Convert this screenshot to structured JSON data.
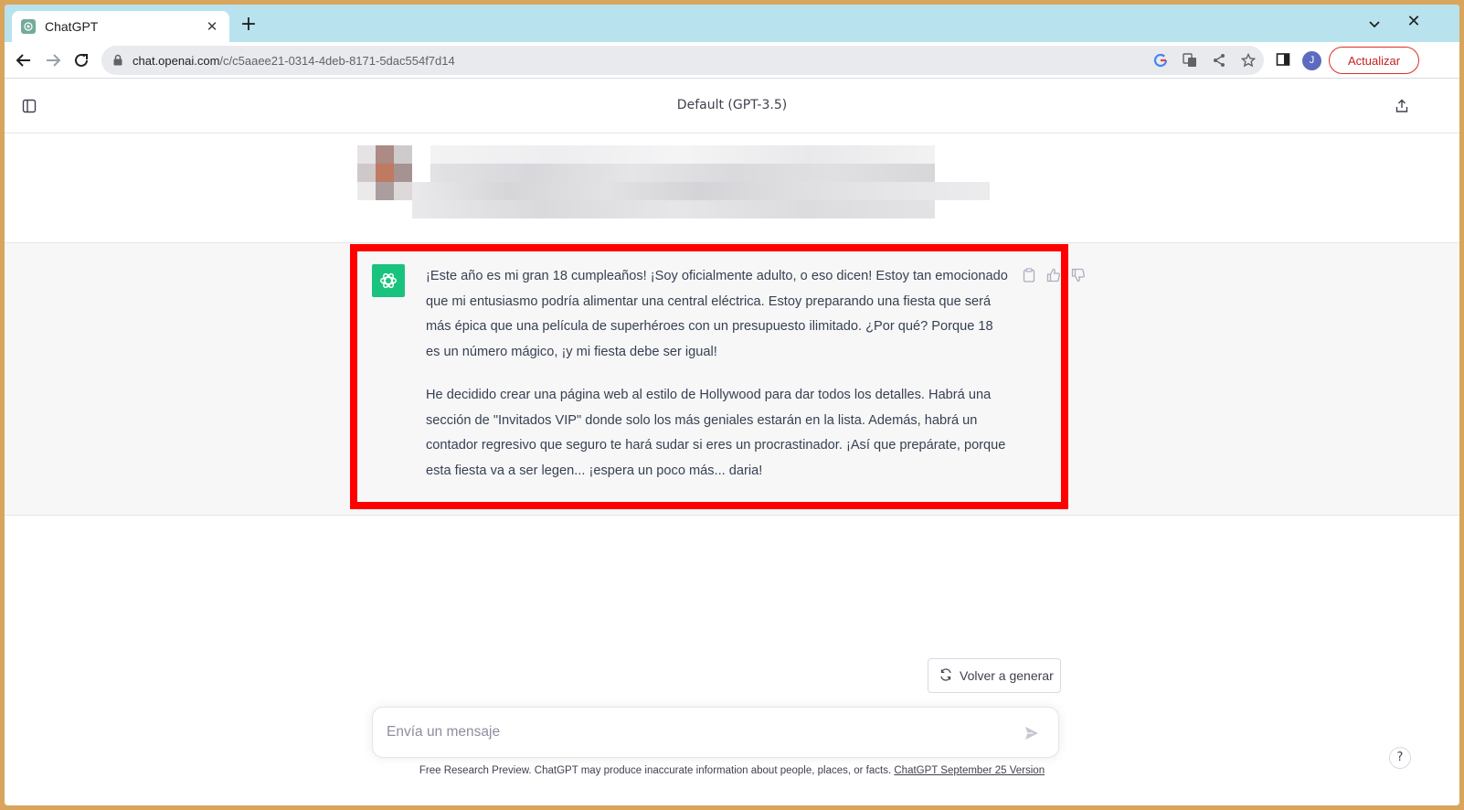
{
  "browser": {
    "tab_title": "ChatGPT",
    "url_domain": "chat.openai.com",
    "url_path": "/c/c5aaee21-0314-4deb-8171-5dac554f7d14",
    "update_label": "Actualizar",
    "profile_initial": "J"
  },
  "chat": {
    "model_title": "Default (GPT-3.5)",
    "assistant_paragraphs": [
      "¡Este año es mi gran 18 cumpleaños! ¡Soy oficialmente adulto, o eso dicen! Estoy tan emocionado que mi entusiasmo podría alimentar una central eléctrica. Estoy preparando una fiesta que será más épica que una película de superhéroes con un presupuesto ilimitado. ¿Por qué? Porque 18 es un número mágico, ¡y mi fiesta debe ser igual!",
      "He decidido crear una página web al estilo de Hollywood para dar todos los detalles. Habrá una sección de \"Invitados VIP\" donde solo los más geniales estarán en la lista. Además, habrá un contador regresivo que seguro te hará sudar si eres un procrastinador. ¡Así que prepárate, porque esta fiesta va a ser legen... ¡espera un poco más... daria!"
    ],
    "regenerate_label": "Volver a generar",
    "composer_placeholder": "Envía un mensaje",
    "footer_text": "Free Research Preview. ChatGPT may produce inaccurate information about people, places, or facts.",
    "footer_link": "ChatGPT September 25 Version",
    "help_label": "?"
  },
  "colors": {
    "highlight": "#ff0000",
    "gpt_green": "#19c37d",
    "tab_strip": "#b8e3ee"
  },
  "icons": {
    "tab_favicon": "openai-logo-icon",
    "sidebar": "sidebar-toggle-icon",
    "share": "share-icon",
    "copy": "clipboard-icon",
    "thumbs_up": "thumbs-up-icon",
    "thumbs_down": "thumbs-down-icon",
    "regenerate": "refresh-icon",
    "send": "send-icon"
  }
}
